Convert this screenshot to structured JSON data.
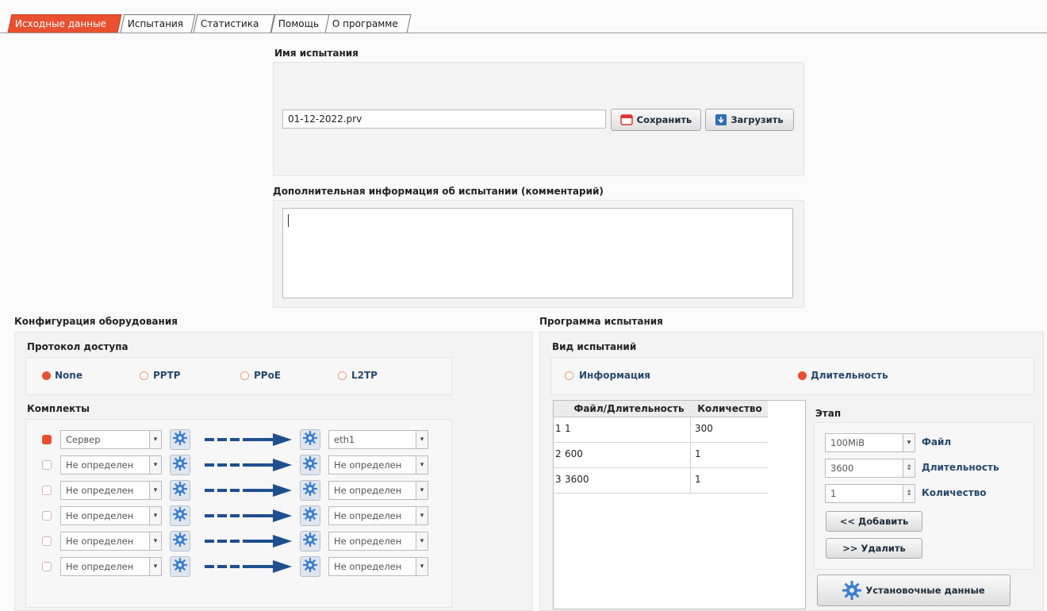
{
  "tabs": [
    {
      "label": "Исходные данные",
      "active": true
    },
    {
      "label": "Испытания",
      "active": false
    },
    {
      "label": "Статистика",
      "active": false
    },
    {
      "label": "Помощь",
      "active": false
    },
    {
      "label": "О программе",
      "active": false
    }
  ],
  "test_name": {
    "label": "Имя испытания",
    "value": "01-12-2022.prv",
    "save_label": "Сохранить",
    "load_label": "Загрузить"
  },
  "comment": {
    "label": "Дополнительная информация об испытании (комментарий)",
    "value": ""
  },
  "hardware": {
    "title": "Конфигурация оборудования",
    "protocol_label": "Протокол доступа",
    "protocols": [
      {
        "label": "None",
        "selected": true
      },
      {
        "label": "PPTP",
        "selected": false
      },
      {
        "label": "PPoE",
        "selected": false
      },
      {
        "label": "L2TP",
        "selected": false
      }
    ],
    "kits_label": "Комплекты",
    "kits": [
      {
        "checked": true,
        "left": "Сервер",
        "right": "eth1"
      },
      {
        "checked": false,
        "left": "Не определен",
        "right": "Не определен"
      },
      {
        "checked": false,
        "left": "Не определен",
        "right": "Не определен"
      },
      {
        "checked": false,
        "left": "Не определен",
        "right": "Не определен"
      },
      {
        "checked": false,
        "left": "Не определен",
        "right": "Не определен"
      },
      {
        "checked": false,
        "left": "Не определен",
        "right": "Не определен"
      }
    ]
  },
  "program": {
    "title": "Программа испытания",
    "type_label": "Вид испытаний",
    "types": [
      {
        "label": "Информация",
        "selected": false
      },
      {
        "label": "Длительность",
        "selected": true
      }
    ],
    "table": {
      "headers": [
        "Файл/Длительность",
        "Количество"
      ],
      "rows": [
        {
          "num": "1",
          "file": "1",
          "count": "300"
        },
        {
          "num": "2",
          "file": "600",
          "count": "1"
        },
        {
          "num": "3",
          "file": "3600",
          "count": "1"
        }
      ]
    },
    "stage": {
      "label": "Этап",
      "file_value": "100MiB",
      "file_label": "Файл",
      "duration_value": "3600",
      "duration_label": "Длительность",
      "count_value": "1",
      "count_label": "Количество",
      "add_label": "<< Добавить",
      "remove_label": ">> Удалить"
    },
    "setup_label": "Установочные данные"
  },
  "colors": {
    "accent": "#e8502f",
    "arrow": "#1f4f8f"
  }
}
